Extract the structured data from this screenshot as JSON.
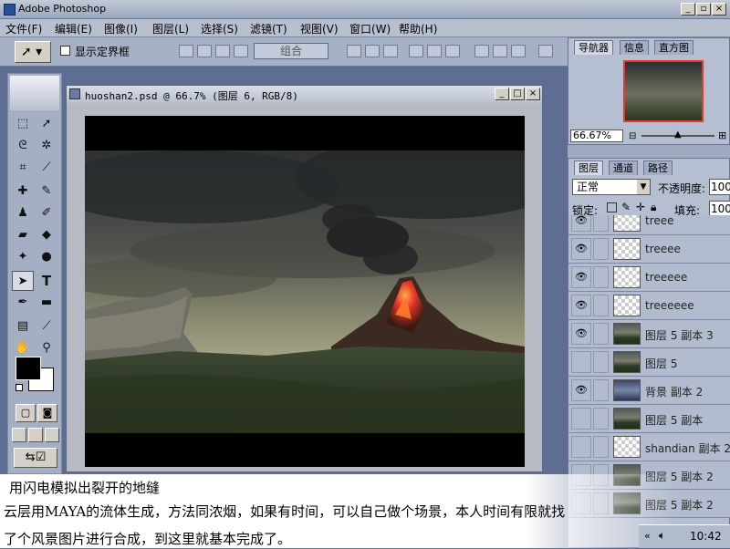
{
  "app": {
    "title": "Adobe Photoshop"
  },
  "menu": [
    "文件(F)",
    "编辑(E)",
    "图像(I)",
    "图层(L)",
    "选择(S)",
    "滤镜(T)",
    "视图(V)",
    "窗口(W)",
    "帮助(H)"
  ],
  "options": {
    "show_bounds_label": "显示定界框",
    "group_button": "组合"
  },
  "document": {
    "title": "huoshan2.psd @ 66.7% (图层 6, RGB/8)"
  },
  "navigator": {
    "tabs": [
      "导航器",
      "信息",
      "直方图"
    ],
    "zoom": "66.67%"
  },
  "layers_panel": {
    "tabs": [
      "图层",
      "通道",
      "路径"
    ],
    "blend_mode": "正常",
    "opacity_label": "不透明度:",
    "opacity_value": "100",
    "lock_label": "锁定:",
    "fill_label": "填充:",
    "fill_value": "100",
    "layers": [
      {
        "name": "treee",
        "visible": true,
        "thumb": "transparent"
      },
      {
        "name": "treeee",
        "visible": true,
        "thumb": "transparent"
      },
      {
        "name": "treeeee",
        "visible": true,
        "thumb": "transparent"
      },
      {
        "name": "treeeeee",
        "visible": true,
        "thumb": "transparent"
      },
      {
        "name": "图层 5 副本 3",
        "visible": true,
        "thumb": "landscape"
      },
      {
        "name": "图层 5",
        "visible": false,
        "thumb": "landscape"
      },
      {
        "name": "背景 副本 2",
        "visible": true,
        "thumb": "sky"
      },
      {
        "name": "图层 5 副本",
        "visible": false,
        "thumb": "landscape"
      },
      {
        "name": "shandian 副本 2",
        "visible": false,
        "thumb": "transparent"
      },
      {
        "name": "图层 5 副本 2",
        "visible": false,
        "thumb": "landscape"
      },
      {
        "name": "图层 5 副本 2",
        "visible": false,
        "thumb": "landscape"
      }
    ]
  },
  "caption": {
    "line1": "用闪电模拟出裂开的地缝",
    "line2": "云层用MAYA的流体生成，方法同浓烟，如果有时间，可以自己做个场景，本人时间有限就找",
    "line3": "了个风景图片进行合成，到这里就基本完成了。"
  },
  "tray": {
    "time": "10:42"
  },
  "colors": {
    "accent": "#e8382a",
    "title_bg": "#9aa7bf"
  }
}
